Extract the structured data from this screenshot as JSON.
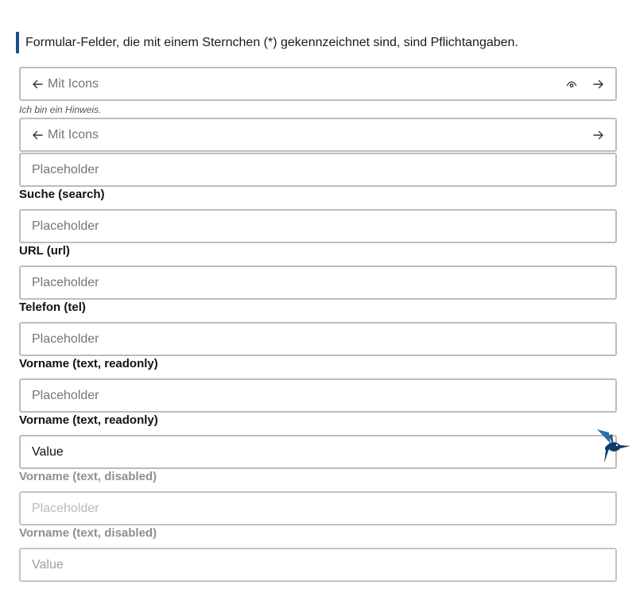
{
  "notice": {
    "text": "Formular-Felder, die mit einem Sternchen (*) gekennzeichnet sind, sind Pflichtangaben."
  },
  "fields": [
    {
      "kind": "icons",
      "placeholder": "Mit Icons",
      "icons": [
        "arrow-left-icon",
        "eye-icon",
        "arrow-right-icon"
      ]
    },
    {
      "kind": "icons",
      "placeholder": "Mit Icons",
      "icons": [
        "arrow-left-icon",
        "arrow-right-icon"
      ]
    },
    {
      "kind": "text",
      "placeholder": "Placeholder"
    },
    {
      "label": "Suche (search)",
      "placeholder": "Placeholder"
    },
    {
      "label": "URL (url)",
      "placeholder": "Placeholder"
    },
    {
      "label": "Telefon (tel)",
      "placeholder": "Placeholder"
    },
    {
      "label": "Vorname (text, readonly)",
      "placeholder": "Placeholder"
    },
    {
      "label": "Vorname (text, readonly)",
      "value": "Value"
    },
    {
      "label": "Vorname (text, disabled)",
      "placeholder": "Placeholder"
    },
    {
      "label": "Vorname (text, disabled)",
      "value": "Value"
    }
  ],
  "hint": "Ich bin ein Hinweis.",
  "colors": {
    "accent": "#1f4e89",
    "border": "#bdbdbd",
    "placeholder": "#757575",
    "disabled_text": "#9e9e9e"
  },
  "decoration": {
    "icon": "hummingbird-logo-icon"
  }
}
